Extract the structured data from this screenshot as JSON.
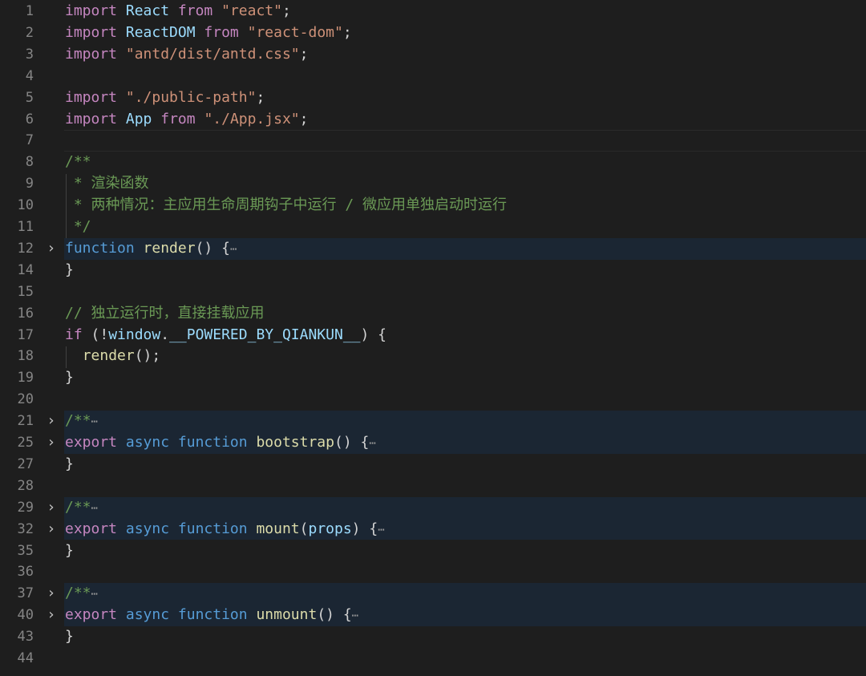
{
  "editor": {
    "lines": [
      {
        "num": "1",
        "tokens": [
          [
            "kw",
            "import"
          ],
          [
            "pun",
            " "
          ],
          [
            "id",
            "React"
          ],
          [
            "pun",
            " "
          ],
          [
            "kw",
            "from"
          ],
          [
            "pun",
            " "
          ],
          [
            "str",
            "\"react\""
          ],
          [
            "pun",
            ";"
          ]
        ]
      },
      {
        "num": "2",
        "tokens": [
          [
            "kw",
            "import"
          ],
          [
            "pun",
            " "
          ],
          [
            "id",
            "ReactDOM"
          ],
          [
            "pun",
            " "
          ],
          [
            "kw",
            "from"
          ],
          [
            "pun",
            " "
          ],
          [
            "str",
            "\"react-dom\""
          ],
          [
            "pun",
            ";"
          ]
        ]
      },
      {
        "num": "3",
        "tokens": [
          [
            "kw",
            "import"
          ],
          [
            "pun",
            " "
          ],
          [
            "str",
            "\"antd/dist/antd.css\""
          ],
          [
            "pun",
            ";"
          ]
        ]
      },
      {
        "num": "4",
        "tokens": []
      },
      {
        "num": "5",
        "tokens": [
          [
            "kw",
            "import"
          ],
          [
            "pun",
            " "
          ],
          [
            "str",
            "\"./public-path\""
          ],
          [
            "pun",
            ";"
          ]
        ]
      },
      {
        "num": "6",
        "tokens": [
          [
            "kw",
            "import"
          ],
          [
            "pun",
            " "
          ],
          [
            "id",
            "App"
          ],
          [
            "pun",
            " "
          ],
          [
            "kw",
            "from"
          ],
          [
            "pun",
            " "
          ],
          [
            "str",
            "\"./App.jsx\""
          ],
          [
            "pun",
            ";"
          ]
        ]
      },
      {
        "num": "7",
        "tokens": [],
        "cursor": true
      },
      {
        "num": "8",
        "tokens": [
          [
            "cm",
            "/**"
          ]
        ]
      },
      {
        "num": "9",
        "tokens": [
          [
            "cm",
            " * 渲染函数"
          ]
        ]
      },
      {
        "num": "10",
        "tokens": [
          [
            "cm",
            " * 两种情况：主应用生命周期钩子中运行 / 微应用单独启动时运行"
          ]
        ]
      },
      {
        "num": "11",
        "tokens": [
          [
            "cm",
            " */"
          ]
        ]
      },
      {
        "num": "12",
        "fold": "›",
        "folded": true,
        "tokens": [
          [
            "kwb",
            "function"
          ],
          [
            "pun",
            " "
          ],
          [
            "fn",
            "render"
          ],
          [
            "pun",
            "() {"
          ],
          [
            "ell",
            "⋯"
          ]
        ]
      },
      {
        "num": "14",
        "tokens": [
          [
            "pun",
            "}"
          ]
        ]
      },
      {
        "num": "15",
        "tokens": []
      },
      {
        "num": "16",
        "tokens": [
          [
            "cm",
            "// 独立运行时，直接挂载应用"
          ]
        ]
      },
      {
        "num": "17",
        "tokens": [
          [
            "kw",
            "if"
          ],
          [
            "pun",
            " (!"
          ],
          [
            "id",
            "window"
          ],
          [
            "pun",
            "."
          ],
          [
            "id",
            "__POWERED_BY_QIANKUN__"
          ],
          [
            "pun",
            ") {"
          ]
        ]
      },
      {
        "num": "18",
        "tokens": [
          [
            "pun",
            "  "
          ],
          [
            "fn",
            "render"
          ],
          [
            "pun",
            "();"
          ]
        ]
      },
      {
        "num": "19",
        "tokens": [
          [
            "pun",
            "}"
          ]
        ]
      },
      {
        "num": "20",
        "tokens": []
      },
      {
        "num": "21",
        "fold": "›",
        "folded": true,
        "tokens": [
          [
            "cm",
            "/**"
          ],
          [
            "ell",
            "⋯"
          ]
        ]
      },
      {
        "num": "25",
        "fold": "›",
        "folded": true,
        "tokens": [
          [
            "kw",
            "export"
          ],
          [
            "pun",
            " "
          ],
          [
            "kwb",
            "async"
          ],
          [
            "pun",
            " "
          ],
          [
            "kwb",
            "function"
          ],
          [
            "pun",
            " "
          ],
          [
            "fn",
            "bootstrap"
          ],
          [
            "pun",
            "() {"
          ],
          [
            "ell",
            "⋯"
          ]
        ]
      },
      {
        "num": "27",
        "tokens": [
          [
            "pun",
            "}"
          ]
        ]
      },
      {
        "num": "28",
        "tokens": []
      },
      {
        "num": "29",
        "fold": "›",
        "folded": true,
        "tokens": [
          [
            "cm",
            "/**"
          ],
          [
            "ell",
            "⋯"
          ]
        ]
      },
      {
        "num": "32",
        "fold": "›",
        "folded": true,
        "tokens": [
          [
            "kw",
            "export"
          ],
          [
            "pun",
            " "
          ],
          [
            "kwb",
            "async"
          ],
          [
            "pun",
            " "
          ],
          [
            "kwb",
            "function"
          ],
          [
            "pun",
            " "
          ],
          [
            "fn",
            "mount"
          ],
          [
            "pun",
            "("
          ],
          [
            "id",
            "props"
          ],
          [
            "pun",
            ") {"
          ],
          [
            "ell",
            "⋯"
          ]
        ]
      },
      {
        "num": "35",
        "tokens": [
          [
            "pun",
            "}"
          ]
        ]
      },
      {
        "num": "36",
        "tokens": []
      },
      {
        "num": "37",
        "fold": "›",
        "folded": true,
        "tokens": [
          [
            "cm",
            "/**"
          ],
          [
            "ell",
            "⋯"
          ]
        ]
      },
      {
        "num": "40",
        "fold": "›",
        "folded": true,
        "tokens": [
          [
            "kw",
            "export"
          ],
          [
            "pun",
            " "
          ],
          [
            "kwb",
            "async"
          ],
          [
            "pun",
            " "
          ],
          [
            "kwb",
            "function"
          ],
          [
            "pun",
            " "
          ],
          [
            "fn",
            "unmount"
          ],
          [
            "pun",
            "() {"
          ],
          [
            "ell",
            "⋯"
          ]
        ]
      },
      {
        "num": "43",
        "tokens": [
          [
            "pun",
            "}"
          ]
        ]
      },
      {
        "num": "44",
        "tokens": []
      }
    ],
    "colors": {
      "background": "#1e1e1e",
      "folded_highlight": "#1b2633",
      "keyword_control": "#c586c0",
      "keyword_storage": "#569cd6",
      "string": "#ce9178",
      "identifier": "#9cdcfe",
      "function": "#dcdcaa",
      "comment": "#6a9955",
      "line_number": "#858585"
    },
    "fold_icon": "chevron-right-icon",
    "ellipsis_icon": "folded-ellipsis-icon"
  }
}
